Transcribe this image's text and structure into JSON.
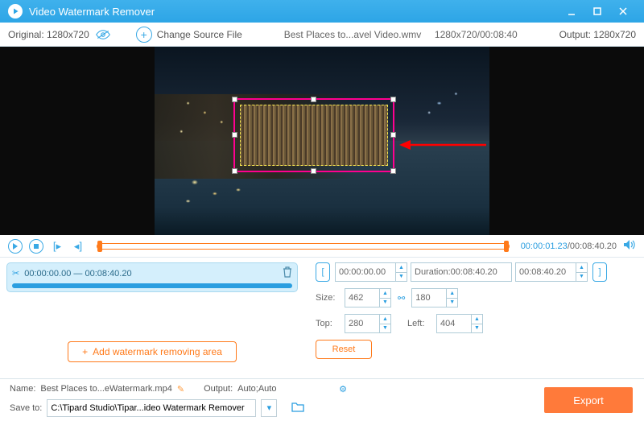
{
  "titlebar": {
    "title": "Video Watermark Remover"
  },
  "toolbar": {
    "original_label": "Original:",
    "original_res": "1280x720",
    "change_label": "Change Source File",
    "filename": "Best Places to...avel Video.wmv",
    "file_info": "1280x720/00:08:40",
    "output_label": "Output:",
    "output_res": "1280x720"
  },
  "playbar": {
    "current_time": "00:00:01.23",
    "total_time": "00:08:40.20"
  },
  "clip": {
    "start": "00:00:00.00",
    "sep": "—",
    "end": "00:08:40.20"
  },
  "add_area_label": "Add watermark removing area",
  "timerow": {
    "start": "00:00:00.00",
    "dur_label": "Duration:",
    "dur_val": "00:08:40.20",
    "end": "00:08:40.20"
  },
  "size": {
    "label": "Size:",
    "w": "462",
    "h": "180"
  },
  "pos": {
    "top_label": "Top:",
    "top": "280",
    "left_label": "Left:",
    "left": "404"
  },
  "reset_label": "Reset",
  "bottom": {
    "name_label": "Name:",
    "name_val": "Best Places to...eWatermark.mp4",
    "output_label": "Output:",
    "output_val": "Auto;Auto",
    "save_label": "Save to:",
    "save_path": "C:\\Tipard Studio\\Tipar...ideo Watermark Remover",
    "export_label": "Export"
  }
}
